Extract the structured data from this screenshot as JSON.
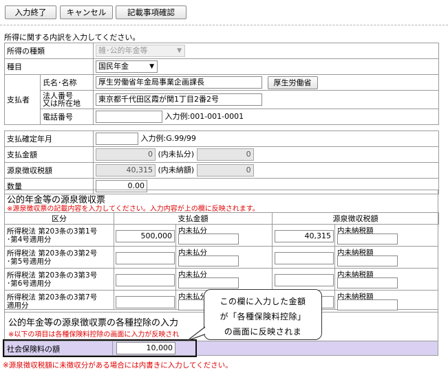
{
  "toolbar": {
    "finish_label": "入力終了",
    "cancel_label": "キャンセル",
    "confirm_label": "記載事項確認"
  },
  "intro_text": "所得に関する内訳を入力してください。",
  "form": {
    "income_type_label": "所得の種類",
    "income_type_value": "雑･公的年金等",
    "category_label": "種目",
    "category_value": "国民年金",
    "payer_label": "支払者",
    "name_label": "氏名･名称",
    "name_value": "厚生労働省年金局事業企画課長",
    "mhlw_button": "厚生労働省",
    "corp_label_1": "法人番号",
    "corp_label_2": "又は所在地",
    "address_value": "東京都千代田区霞が関1丁目2番2号",
    "phone_label": "電話番号",
    "phone_hint": "入力例:001-001-0001",
    "pay_date_label": "支払確定年月",
    "pay_date_hint": "入力例:G.99/99",
    "amount_label": "支払金額",
    "amount_value": "0",
    "amount_unpaid_label": "(内未払分)",
    "amount_unpaid_value": "0",
    "withholding_label": "源泉徴収税額",
    "withholding_value": "40,315",
    "withholding_unpaid_label": "(内未納額)",
    "withholding_unpaid_value": "0",
    "quantity_label": "数量",
    "quantity_value": "0.00"
  },
  "slip": {
    "title": "公的年金等の源泉徴収票",
    "note": "※源泉徴収票の記載内容を入力してください。入力内容が上の欄に反映されます。",
    "col_category": "区分",
    "col_amount": "支払金額",
    "col_withholding": "源泉徴収税額",
    "unpaid_label": "内未払分",
    "unpaid_tax_label": "内未納税額",
    "rows": [
      {
        "line1": "所得税法 第203条の3第1号",
        "line2": "･第4号適用分",
        "amount": "500,000",
        "tax": "40,315"
      },
      {
        "line1": "所得税法 第203条の3第2号",
        "line2": "･第5号適用分",
        "amount": "",
        "tax": ""
      },
      {
        "line1": "所得税法 第203条の3第3号",
        "line2": "･第6号適用分",
        "amount": "",
        "tax": ""
      },
      {
        "line1": "所得税法 第203条の3第7号",
        "line2": "適用分",
        "amount": "",
        "tax": ""
      }
    ],
    "deduction_title": "公的年金等の源泉徴収票の各種控除の入力",
    "deduction_note": "※以下の項目は各種保険料控除の画面に入力が反映され",
    "insurance_label": "社会保険料の額",
    "insurance_value": "10,000",
    "bottom_note": "※源泉徴収税額に未徴収分がある場合には内書きに入力してください。"
  },
  "callout": {
    "line1": "この欄に入力した金額",
    "line2": "が「各種保険料控除」",
    "line3": "の画面に反映されま"
  }
}
